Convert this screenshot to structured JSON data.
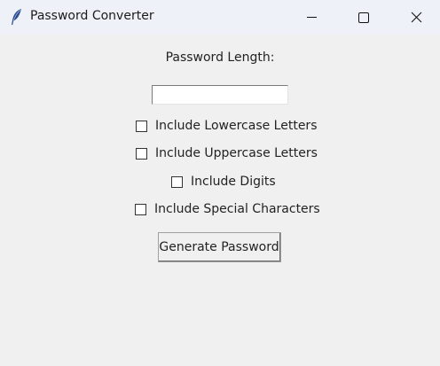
{
  "window": {
    "title": "Password Converter",
    "icon": "feather-icon",
    "controls": [
      "minimize-icon",
      "maximize-icon",
      "close-icon"
    ]
  },
  "form": {
    "length_label": "Password Length:",
    "length_value": "",
    "options": [
      {
        "label": "Include Lowercase Letters",
        "checked": false
      },
      {
        "label": "Include Uppercase Letters",
        "checked": false
      },
      {
        "label": "Include Digits",
        "checked": false
      },
      {
        "label": "Include Special Characters",
        "checked": false
      }
    ],
    "generate_label": "Generate Password"
  }
}
